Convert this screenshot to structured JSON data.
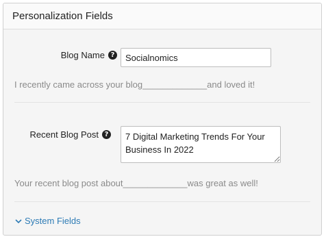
{
  "header": {
    "title": "Personalization Fields"
  },
  "fields": [
    {
      "label": "Blog Name",
      "value": "Socialnomics",
      "preview_before": "I recently came across your blog",
      "preview_blank": "_____________",
      "preview_after": "and loved it!"
    },
    {
      "label": "Recent Blog Post",
      "value": "7 Digital Marketing Trends For Your Business In 2022",
      "preview_before": "Your recent blog post about",
      "preview_blank": "_____________",
      "preview_after": "was great as well!"
    }
  ],
  "footer": {
    "system_fields_label": "System Fields"
  },
  "icons": {
    "help": "help-circle-icon",
    "expand": "chevron-down-icon"
  },
  "colors": {
    "link": "#2d7bb5",
    "muted_text": "#8a8a8a"
  }
}
